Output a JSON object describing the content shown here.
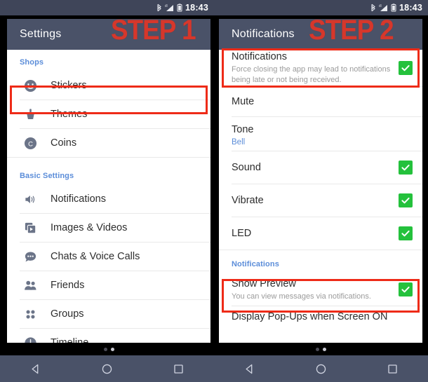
{
  "status_bar": {
    "time": "18:43",
    "icons": [
      "bluetooth-icon",
      "signal-icon",
      "battery-icon"
    ]
  },
  "colors": {
    "appbar": "#4a5268",
    "step_red": "#d6372b",
    "highlight_red": "#ee2b18",
    "checkbox_green": "#24c13c",
    "section_blue": "#5b8dd9"
  },
  "left_pane": {
    "appbar_title": "Settings",
    "step_badge": "STEP 1",
    "sections": [
      {
        "header": "Shops",
        "items": [
          {
            "label": "Stickers",
            "icon": "smiley-icon"
          },
          {
            "label": "Themes",
            "icon": "paintbrush-icon"
          },
          {
            "label": "Coins",
            "icon": "coin-icon"
          }
        ]
      },
      {
        "header": "Basic Settings",
        "items": [
          {
            "label": "Notifications",
            "icon": "speaker-icon",
            "highlighted": true
          },
          {
            "label": "Images & Videos",
            "icon": "media-icon"
          },
          {
            "label": "Chats & Voice Calls",
            "icon": "chat-bubble-icon"
          },
          {
            "label": "Friends",
            "icon": "people-icon"
          },
          {
            "label": "Groups",
            "icon": "grid-dots-icon"
          },
          {
            "label": "Timeline",
            "icon": "clock-icon"
          }
        ]
      }
    ],
    "page_dots": {
      "count": 2,
      "active_index": 1
    }
  },
  "right_pane": {
    "appbar_title": "Notifications",
    "step_badge": "STEP 2",
    "rows": [
      {
        "title": "Notifications",
        "subtitle": "Force closing the app may lead to notifications being late or not being received.",
        "checked": true,
        "highlighted": true
      },
      {
        "title": "Mute",
        "subtitle": "",
        "checked": false,
        "highlighted": false
      },
      {
        "title": "Tone",
        "subtitle": "Bell",
        "subtitle_style": "blue",
        "checked": false,
        "highlighted": false
      },
      {
        "title": "Sound",
        "subtitle": "",
        "checked": true,
        "highlighted": false
      },
      {
        "title": "Vibrate",
        "subtitle": "",
        "checked": true,
        "highlighted": false
      },
      {
        "title": "LED",
        "subtitle": "",
        "checked": true,
        "highlighted": false
      }
    ],
    "section_header": "Notifications",
    "rows2": [
      {
        "title": "Show Preview",
        "subtitle": "You can view messages via notifications.",
        "checked": true,
        "highlighted": true
      },
      {
        "title": "Display Pop-Ups when Screen ON",
        "subtitle": "",
        "checked": false,
        "highlighted": false
      }
    ],
    "page_dots": {
      "count": 2,
      "active_index": 1
    }
  },
  "nav_bar": {
    "buttons": [
      {
        "name": "back-button",
        "icon": "triangle-left-icon"
      },
      {
        "name": "home-button",
        "icon": "circle-icon"
      },
      {
        "name": "recents-button",
        "icon": "square-icon"
      }
    ]
  }
}
